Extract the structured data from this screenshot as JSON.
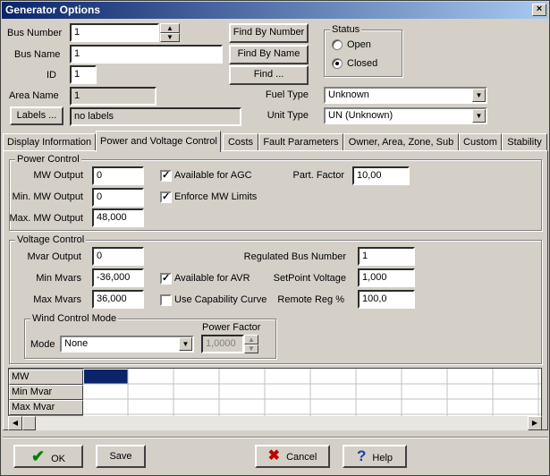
{
  "window": {
    "title": "Generator Options"
  },
  "fields": {
    "bus_number": {
      "label": "Bus Number",
      "value": "1"
    },
    "bus_name": {
      "label": "Bus Name",
      "value": "1"
    },
    "id": {
      "label": "ID",
      "value": "1"
    },
    "area_name": {
      "label": "Area Name",
      "value": "1"
    },
    "labels_button": "Labels ...",
    "labels_value": "no labels"
  },
  "find_buttons": {
    "by_number": "Find By Number",
    "by_name": "Find By Name",
    "find": "Find ..."
  },
  "status": {
    "caption": "Status",
    "open": "Open",
    "closed": "Closed",
    "selected": "Closed"
  },
  "fuel_type": {
    "label": "Fuel Type",
    "value": "Unknown"
  },
  "unit_type": {
    "label": "Unit Type",
    "value": "UN (Unknown)"
  },
  "tabs": [
    {
      "label": "Display Information"
    },
    {
      "label": "Power and Voltage Control"
    },
    {
      "label": "Costs"
    },
    {
      "label": "Fault Parameters"
    },
    {
      "label": "Owner, Area, Zone, Sub"
    },
    {
      "label": "Custom"
    },
    {
      "label": "Stability"
    }
  ],
  "active_tab": "Power and Voltage Control",
  "power_control": {
    "caption": "Power Control",
    "mw_output": {
      "label": "MW Output",
      "value": "0"
    },
    "min_mw_output": {
      "label": "Min. MW Output",
      "value": "0"
    },
    "max_mw_output": {
      "label": "Max. MW Output",
      "value": "48,000"
    },
    "available_agc": {
      "label": "Available for AGC",
      "checked": true
    },
    "enforce_mw_limits": {
      "label": "Enforce MW Limits",
      "checked": true
    },
    "part_factor": {
      "label": "Part. Factor",
      "value": "10,00"
    }
  },
  "voltage_control": {
    "caption": "Voltage Control",
    "mvar_output": {
      "label": "Mvar Output",
      "value": "0"
    },
    "min_mvars": {
      "label": "Min Mvars",
      "value": "-36,000"
    },
    "max_mvars": {
      "label": "Max Mvars",
      "value": "36,000"
    },
    "available_avr": {
      "label": "Available for AVR",
      "checked": true
    },
    "use_capability_curve": {
      "label": "Use Capability Curve",
      "checked": false
    },
    "regulated_bus_number": {
      "label": "Regulated Bus Number",
      "value": "1"
    },
    "setpoint_voltage": {
      "label": "SetPoint Voltage",
      "value": "1,000"
    },
    "remote_reg": {
      "label": "Remote Reg %",
      "value": "100,0"
    }
  },
  "wind_control": {
    "caption": "Wind Control Mode",
    "mode_label": "Mode",
    "mode_value": "None",
    "power_factor_label": "Power Factor",
    "power_factor_value": "1,0000"
  },
  "curve_grid": {
    "rows": [
      "MW",
      "Min Mvar",
      "Max Mvar"
    ]
  },
  "footer": {
    "ok": "OK",
    "save": "Save",
    "cancel": "Cancel",
    "help": "Help"
  },
  "colors": {
    "title_start": "#0a246a",
    "title_end": "#a6caf0",
    "face": "#d4d0c8",
    "grid_selected": "#0a246a"
  },
  "icons": {
    "ok": "check-icon",
    "cancel": "x-icon",
    "help": "question-icon"
  }
}
